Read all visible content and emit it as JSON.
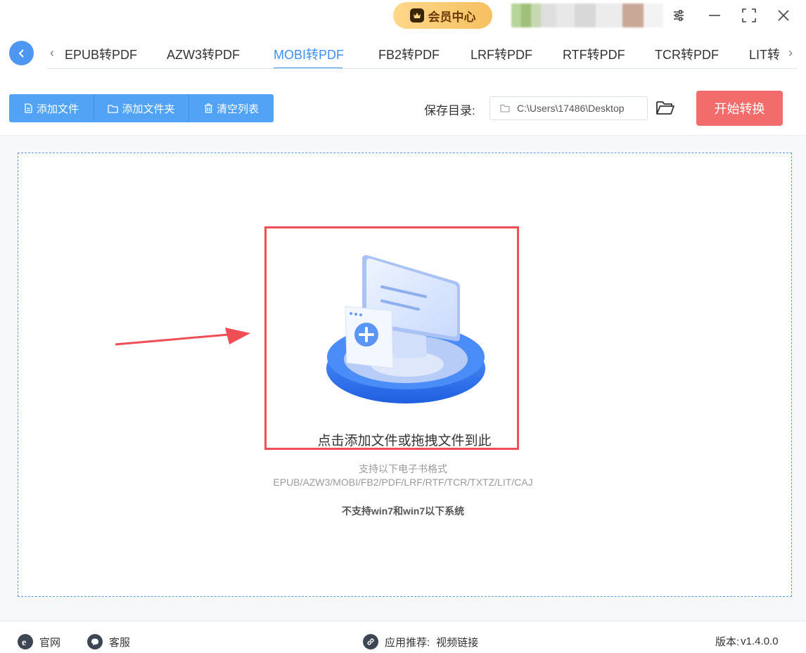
{
  "titlebar": {
    "vip_label": "会员中心",
    "controls": [
      "settings-icon",
      "minimize-icon",
      "maximize-icon",
      "close-icon"
    ]
  },
  "tabs": {
    "items": [
      "EPUB转PDF",
      "AZW3转PDF",
      "MOBI转PDF",
      "FB2转PDF",
      "LRF转PDF",
      "RTF转PDF",
      "TCR转PDF",
      "LIT转"
    ],
    "active": "MOBI转PDF"
  },
  "toolbar": {
    "add_file_label": "添加文件",
    "add_folder_label": "添加文件夹",
    "clear_list_label": "清空列表",
    "save_dir_label": "保存目录:",
    "save_dir_value": "C:\\Users\\17486\\Desktop",
    "start_label": "开始转换"
  },
  "dropzone": {
    "title": "点击添加文件或拖拽文件到此",
    "support_title": "支持以下电子书格式",
    "support_formats": "EPUB/AZW3/MOBI/FB2/PDF/LRF/RTF/TCR/TXTZ/LIT/CAJ",
    "warning": "不支持win7和win7以下系统"
  },
  "footer": {
    "website_label": "官网",
    "service_label": "客服",
    "recommend_label": "应用推荐:",
    "recommend_link": "视频链接",
    "version_label": "版本:",
    "version_value": "v1.4.0.0"
  },
  "colors": {
    "accent": "#3c8ff5",
    "toolbar_button": "#52a3f6",
    "start_button": "#f26c6c",
    "highlight": "#ef4e55",
    "vip": "#f5c060"
  }
}
